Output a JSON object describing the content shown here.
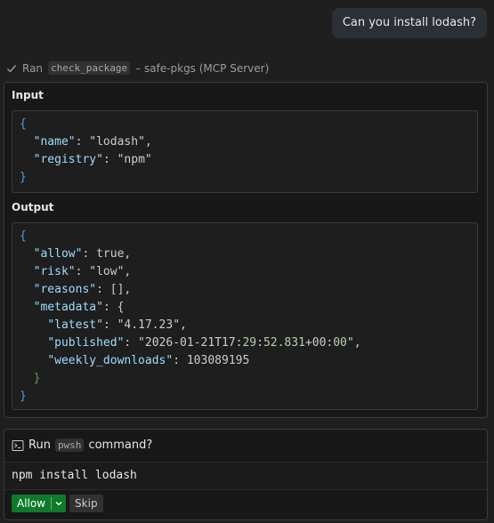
{
  "user_message": "Can you install lodash?",
  "tool_run": {
    "prefix": "Ran",
    "tool_name": "check_package",
    "suffix": "– safe-pkgs (MCP Server)"
  },
  "input_section": {
    "label": "Input",
    "lines": [
      "{",
      "  \"name\": \"lodash\",",
      "  \"registry\": \"npm\"",
      "}"
    ]
  },
  "output_section": {
    "label": "Output",
    "lines": [
      "{",
      "  \"allow\": true,",
      "  \"risk\": \"low\",",
      "  \"reasons\": [],",
      "  \"metadata\": {",
      "    \"latest\": \"4.17.23\",",
      "    \"published\": \"2026-01-21T17:29:52.831+00:00\",",
      "    \"weekly_downloads\": 103089195",
      "  }",
      "}"
    ]
  },
  "command_prompt": {
    "run_label": "Run",
    "shell": "pwsh",
    "command_suffix": "command?",
    "command": "npm install lodash",
    "allow_label": "Allow",
    "skip_label": "Skip"
  },
  "icons": {
    "check": "check-icon",
    "terminal": "terminal-icon",
    "chevron": "chevron-down-icon"
  },
  "colors": {
    "background": "#1f1f1f",
    "allow_button": "#0e7a2b",
    "json_key": "#9cdcfe",
    "json_number": "#b5cea8",
    "json_keyword": "#569cd6"
  }
}
